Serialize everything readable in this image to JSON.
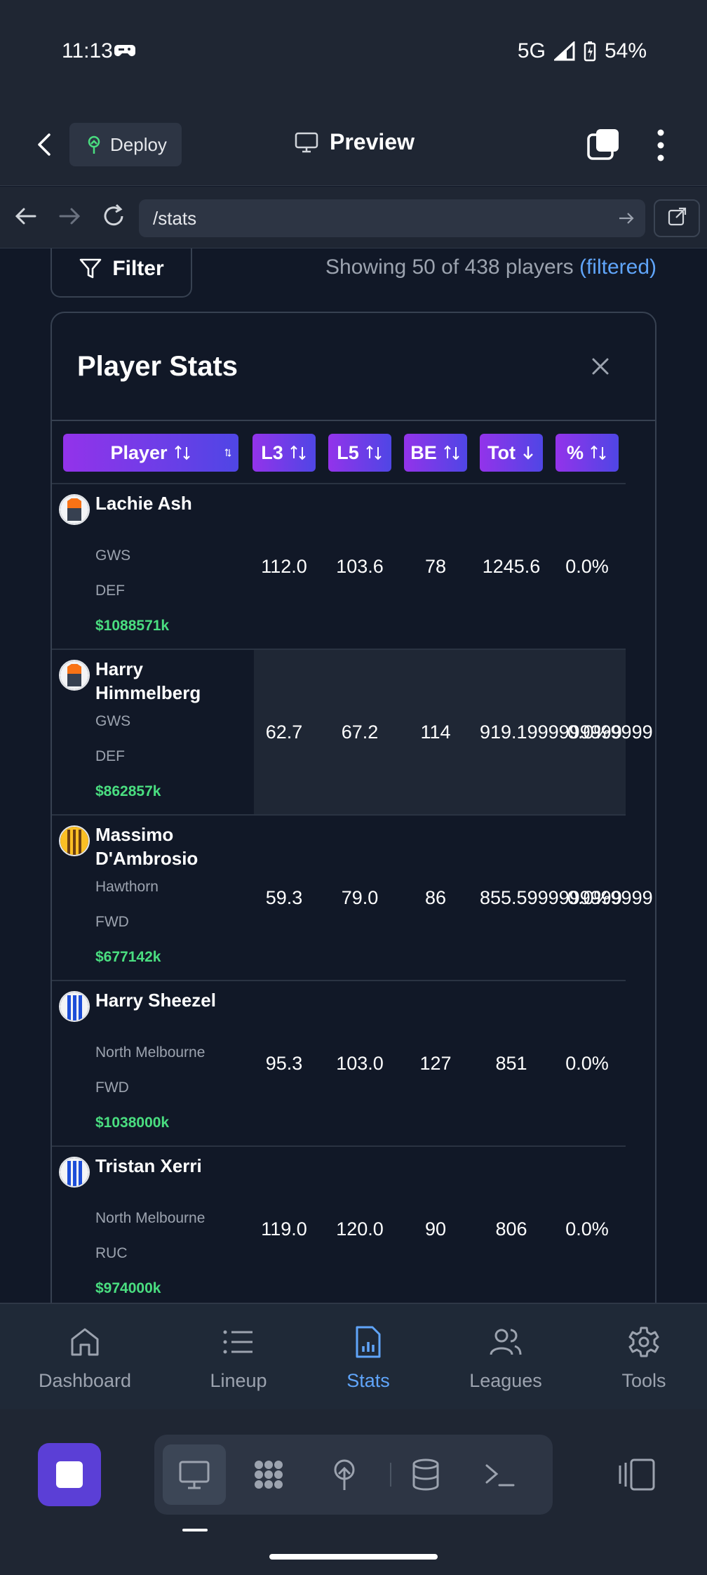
{
  "status_bar": {
    "time": "11:13",
    "network": "5G",
    "battery": "54%"
  },
  "app_header": {
    "deploy_label": "Deploy",
    "title": "Preview"
  },
  "url_bar": {
    "url": "/stats"
  },
  "filter": {
    "label": "Filter",
    "showing_text": "Showing 50 of 438 players",
    "filtered_text": "(filtered)"
  },
  "card": {
    "title": "Player Stats",
    "columns": [
      {
        "label": "Player",
        "sort": "none"
      },
      {
        "label": "L3",
        "sort": "none"
      },
      {
        "label": "L5",
        "sort": "none"
      },
      {
        "label": "BE",
        "sort": "none"
      },
      {
        "label": "Tot",
        "sort": "desc"
      },
      {
        "label": "%",
        "sort": "none"
      }
    ],
    "rows": [
      {
        "name": "Lachie Ash",
        "team": "GWS",
        "position": "DEF",
        "price": "$1088571k",
        "l3": "112.0",
        "l5": "103.6",
        "be": "78",
        "tot": "1245.6",
        "pct": "0.0%",
        "guernsey": "gws"
      },
      {
        "name": "Harry Himmelberg",
        "team": "GWS",
        "position": "DEF",
        "price": "$862857k",
        "l3": "62.7",
        "l5": "67.2",
        "be": "114",
        "tot": "919.1999999999",
        "pct": "0.0%9999",
        "guernsey": "gws"
      },
      {
        "name": "Massimo D'Ambrosio",
        "team": "Hawthorn",
        "position": "FWD",
        "price": "$677142k",
        "l3": "59.3",
        "l5": "79.0",
        "be": "86",
        "tot": "855.5999999999",
        "pct": "0.0%9999",
        "guernsey": "hawthorn"
      },
      {
        "name": "Harry Sheezel",
        "team": "North Melbourne",
        "position": "FWD",
        "price": "$1038000k",
        "l3": "95.3",
        "l5": "103.0",
        "be": "127",
        "tot": "851",
        "pct": "0.0%",
        "guernsey": "north"
      },
      {
        "name": "Tristan Xerri",
        "team": "North Melbourne",
        "position": "RUC",
        "price": "$974000k",
        "l3": "119.0",
        "l5": "120.0",
        "be": "90",
        "tot": "806",
        "pct": "0.0%",
        "guernsey": "north"
      }
    ]
  },
  "bottom_nav": [
    {
      "label": "Dashboard",
      "icon": "home-icon",
      "active": false
    },
    {
      "label": "Lineup",
      "icon": "list-icon",
      "active": false
    },
    {
      "label": "Stats",
      "icon": "stats-file-icon",
      "active": true
    },
    {
      "label": "Leagues",
      "icon": "users-icon",
      "active": false
    },
    {
      "label": "Tools",
      "icon": "gear-icon",
      "active": false
    }
  ],
  "colors": {
    "accent": "#60a5fa",
    "price": "#4ade80",
    "header_gradient_start": "#9333ea",
    "header_gradient_end": "#4f46e5",
    "stop_button": "#5b3fd6"
  }
}
